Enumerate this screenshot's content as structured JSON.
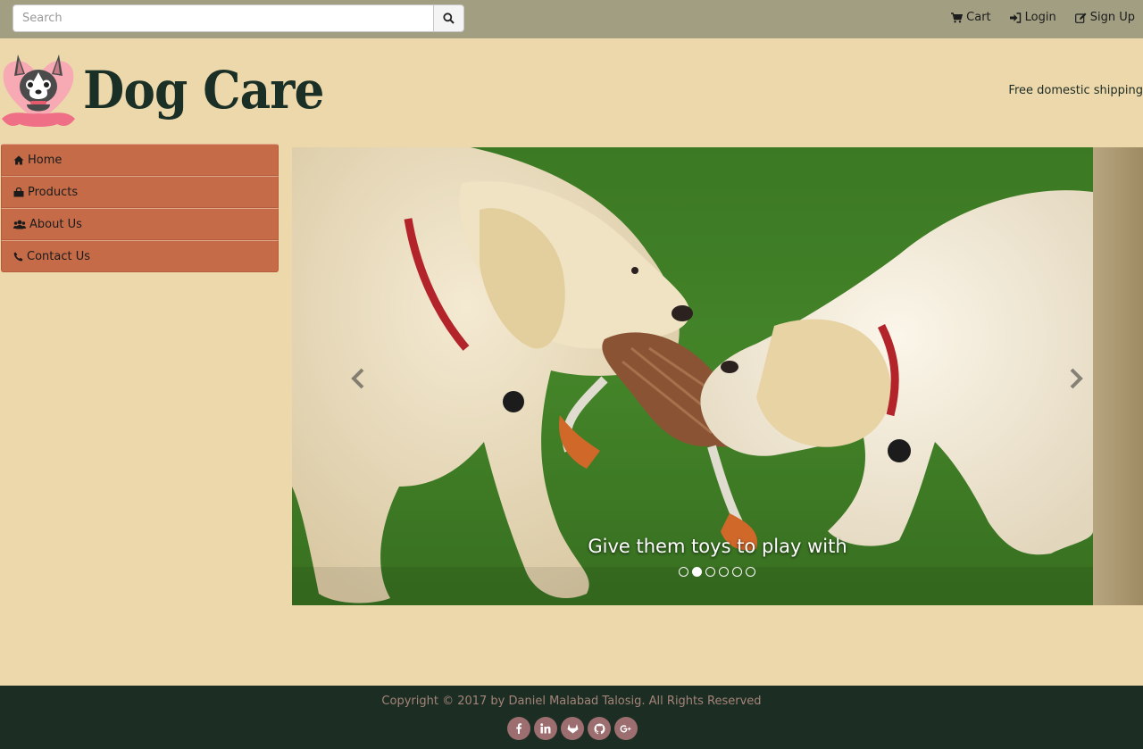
{
  "topbar": {
    "search_placeholder": "Search",
    "links": [
      {
        "label": "Cart",
        "icon": "cart-icon"
      },
      {
        "label": "Login",
        "icon": "login-icon"
      },
      {
        "label": "Sign Up",
        "icon": "edit-icon"
      }
    ]
  },
  "header": {
    "brand": "Dog Care",
    "tagline": "Free domestic shipping"
  },
  "sidebar": {
    "items": [
      {
        "label": "Home",
        "icon": "home-icon"
      },
      {
        "label": "Products",
        "icon": "shopping-bag-icon"
      },
      {
        "label": "About Us",
        "icon": "users-icon"
      },
      {
        "label": "Contact Us",
        "icon": "phone-icon"
      }
    ]
  },
  "carousel": {
    "caption": "Give them toys to play with",
    "slide_count": 6,
    "active_index": 1
  },
  "footer": {
    "copyright": "Copyright © 2017 by Daniel Malabad Talosig. All Rights Reserved",
    "socials": [
      "facebook-icon",
      "linkedin-icon",
      "gitlab-icon",
      "github-icon",
      "google-plus-icon"
    ]
  },
  "colors": {
    "page_bg": "#ecd8ab",
    "topbar_bg": "#a19e82",
    "sidebar_item": "#c56b48",
    "footer_bg": "#1c2d24",
    "social_bg": "#9c6e6f",
    "brand_text": "#1a2f25"
  }
}
